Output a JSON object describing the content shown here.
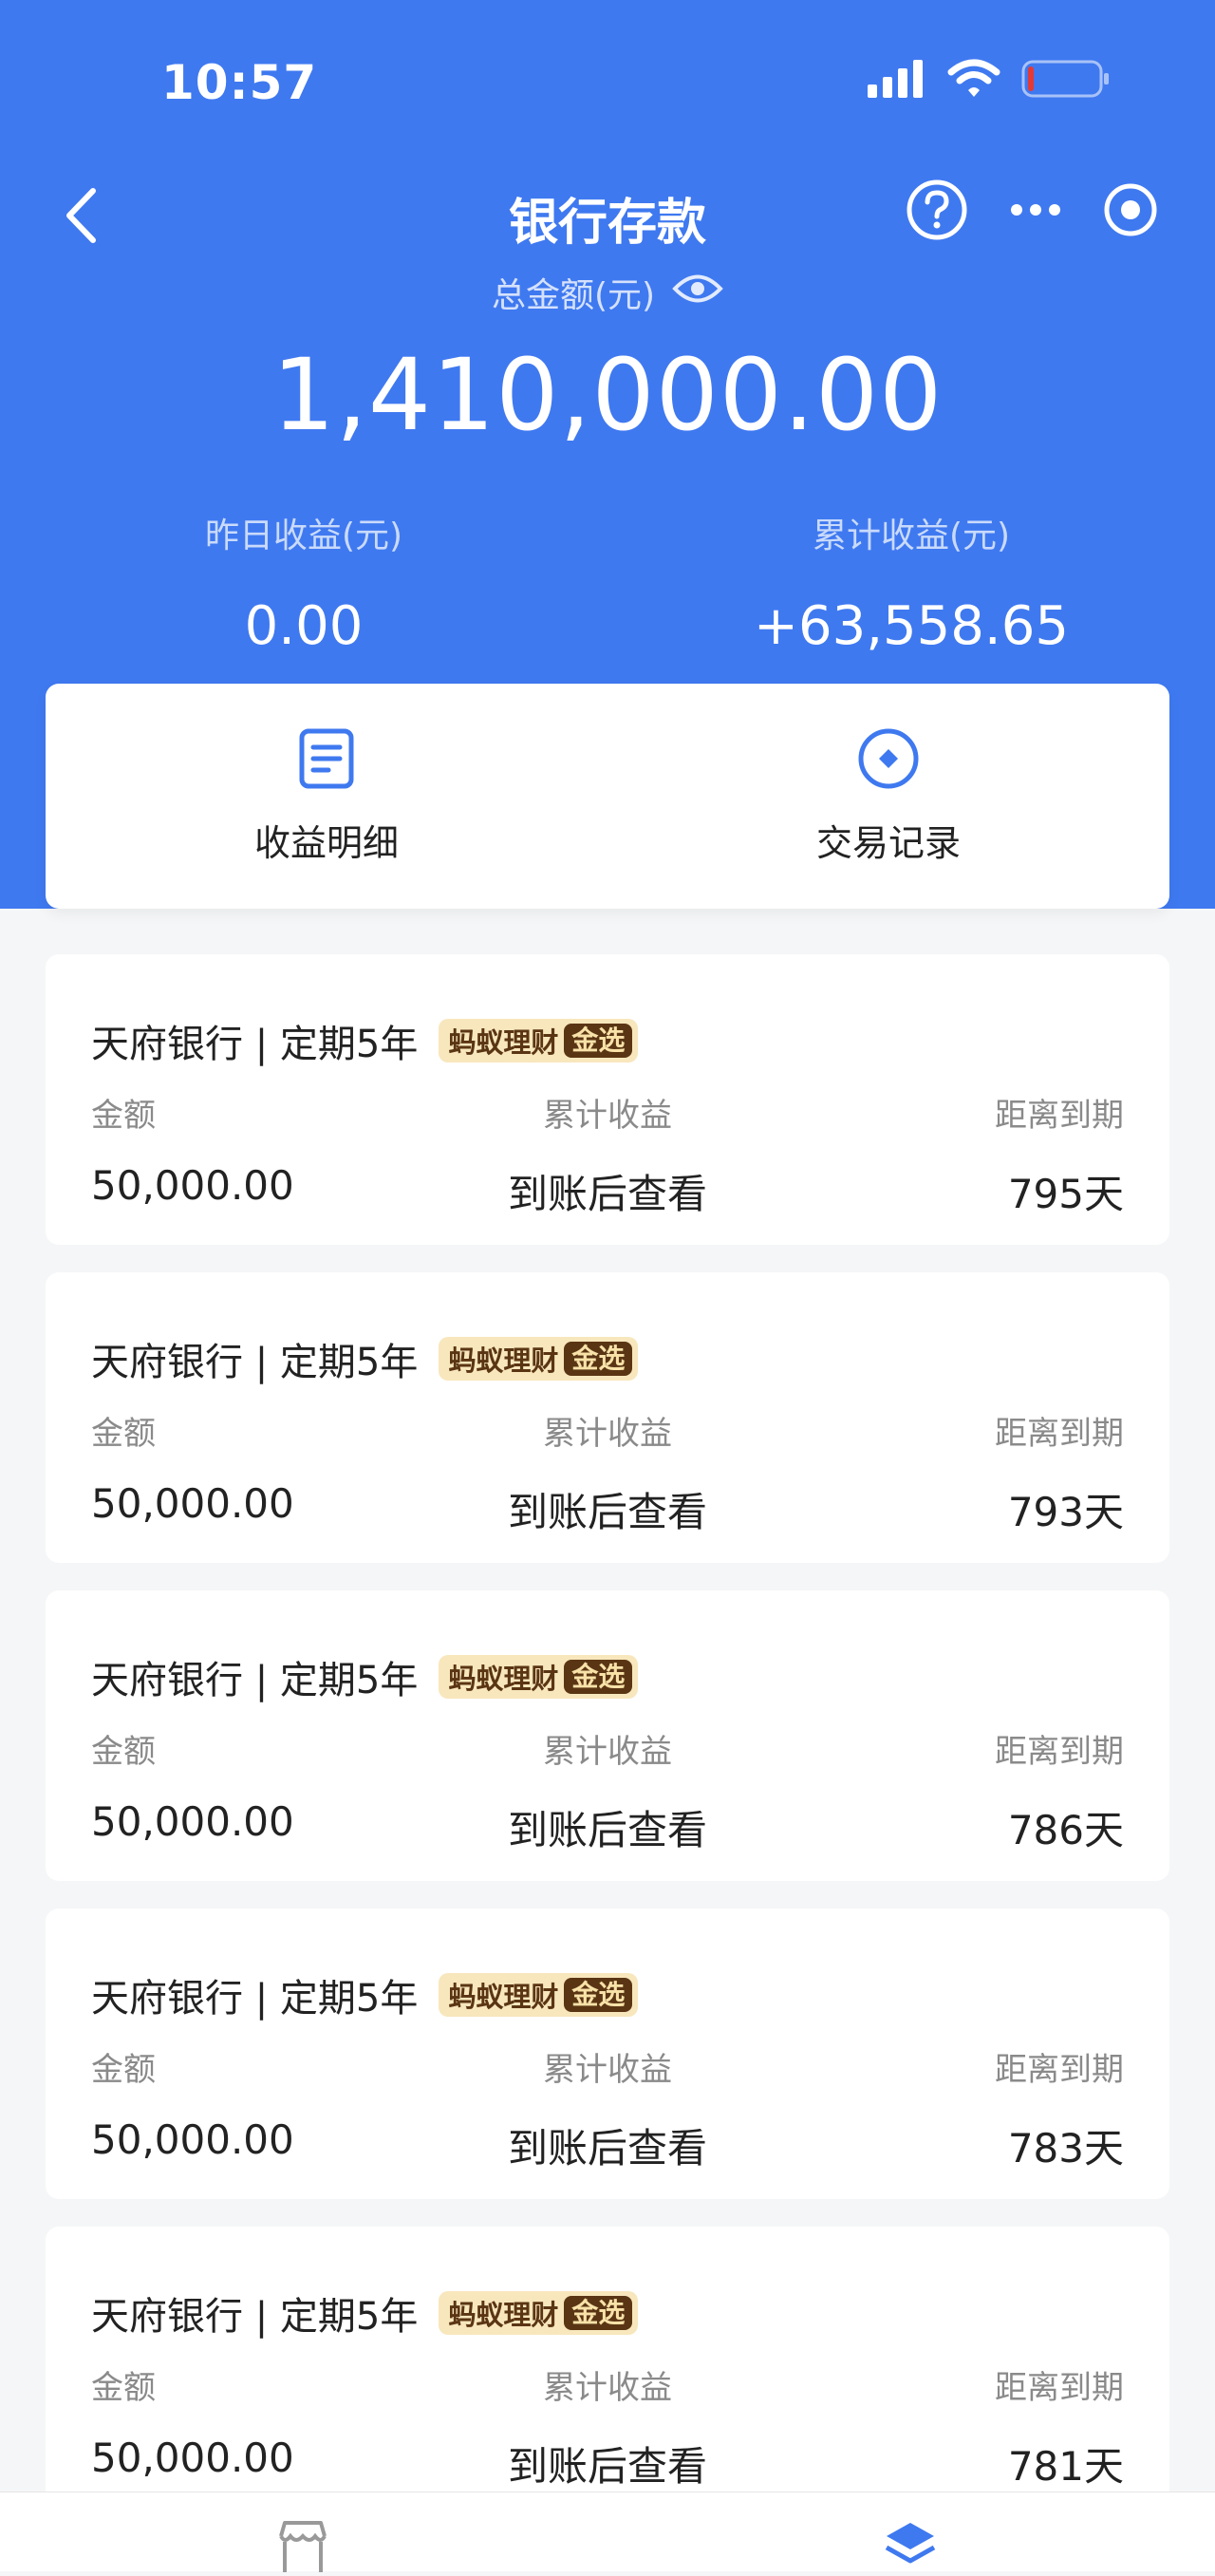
{
  "status_bar": {
    "time": "10:57"
  },
  "nav": {
    "title": "银行存款"
  },
  "summary": {
    "total_label": "总金额(元)",
    "total_amount": "1,410,000.00",
    "yesterday_label": "昨日收益(元)",
    "yesterday_value": "0.00",
    "cumulative_label": "累计收益(元)",
    "cumulative_value": "+63,558.65"
  },
  "actions": [
    {
      "label": "收益明细",
      "icon": "document-list-icon"
    },
    {
      "label": "交易记录",
      "icon": "record-circle-icon"
    }
  ],
  "badge": {
    "text": "蚂蚁理财",
    "gold": "金选"
  },
  "columns": {
    "amount": "金额",
    "earnings": "累计收益",
    "maturity": "距离到期"
  },
  "deposits": [
    {
      "title": "天府银行 | 定期5年",
      "amount": "50,000.00",
      "earnings": "到账后查看",
      "days": "795天"
    },
    {
      "title": "天府银行 | 定期5年",
      "amount": "50,000.00",
      "earnings": "到账后查看",
      "days": "793天"
    },
    {
      "title": "天府银行 | 定期5年",
      "amount": "50,000.00",
      "earnings": "到账后查看",
      "days": "786天"
    },
    {
      "title": "天府银行 | 定期5年",
      "amount": "50,000.00",
      "earnings": "到账后查看",
      "days": "783天"
    },
    {
      "title": "天府银行 | 定期5年",
      "amount": "50,000.00",
      "earnings": "到账后查看",
      "days": "781天"
    }
  ],
  "colors": {
    "brand_blue": "#3f79f0",
    "badge_bg": "#f8e7bd",
    "badge_dark": "#5a3514"
  }
}
